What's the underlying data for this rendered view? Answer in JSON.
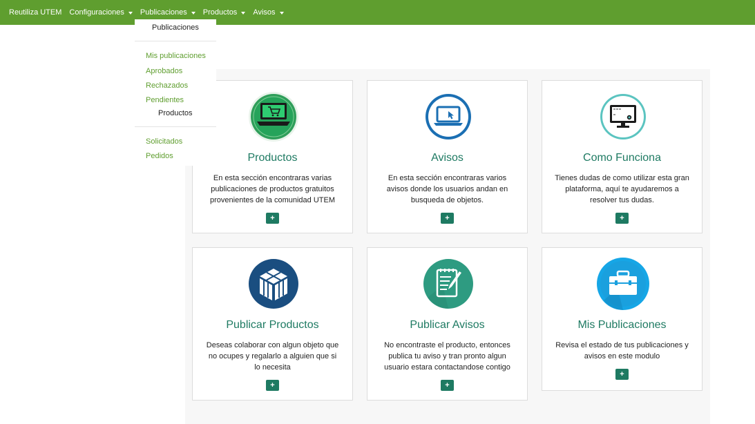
{
  "navbar": {
    "brand": "Reutiliza UTEM",
    "items": [
      {
        "label": "Configuraciones"
      },
      {
        "label": "Publicaciones"
      },
      {
        "label": "Productos"
      },
      {
        "label": "Avisos"
      }
    ]
  },
  "dropdown": {
    "header": "Publicaciones",
    "items": [
      "Mis publicaciones",
      "Aprobados",
      "Rechazados",
      "Pendientes"
    ],
    "subheader": "Productos",
    "items2": [
      "Solicitados",
      "Pedidos"
    ]
  },
  "cards": [
    {
      "title": "Productos",
      "desc": "En esta sección encontraras varias publicaciones de productos gratuitos provenientes de la comunidad UTEM",
      "button": "+",
      "icon": "laptop-cart-icon"
    },
    {
      "title": "Avisos",
      "desc": "En esta sección encontraras varios avisos donde los usuarios andan en busqueda de objetos.",
      "button": "+",
      "icon": "laptop-cursor-icon"
    },
    {
      "title": "Como Funciona",
      "desc": "Tienes dudas de como utilizar esta gran plataforma, aquí te ayudaremos a resolver tus dudas.",
      "button": "+",
      "icon": "monitor-icon"
    },
    {
      "title": "Publicar Productos",
      "desc": "Deseas colaborar con algun objeto que no ocupes y regalarlo a alguien que si lo necesita",
      "button": "+",
      "icon": "box-icon"
    },
    {
      "title": "Publicar Avisos",
      "desc": "No encontraste el producto, entonces publica tu aviso y tran pronto algun usuario estara contactandose contigo",
      "button": "+",
      "icon": "notepad-pen-icon"
    },
    {
      "title": "Mis Publicaciones",
      "desc": "Revisa el estado de tus publicaciones y avisos en este modulo",
      "button": "+",
      "icon": "briefcase-icon"
    }
  ],
  "colors": {
    "navbar": "#5f9e2f",
    "accent": "#1e7a62",
    "link": "#5f9e2f"
  }
}
